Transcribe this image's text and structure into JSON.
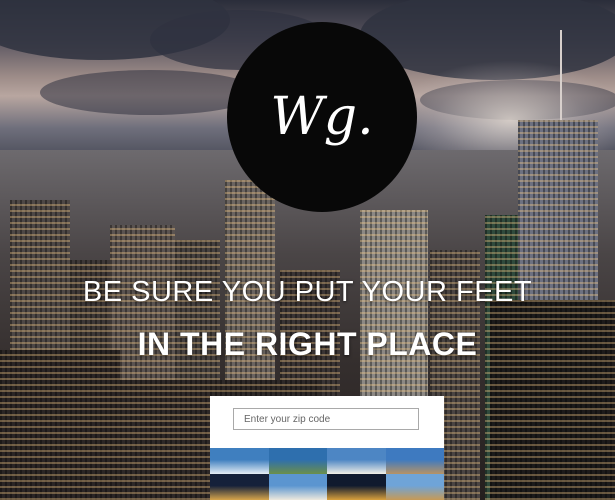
{
  "logo": {
    "text": "Wg."
  },
  "headline": {
    "line1": "BE SURE YOU PUT YOUR FEET",
    "line2": "IN THE RIGHT PLACE"
  },
  "search": {
    "placeholder": "Enter your zip code",
    "value": ""
  },
  "thumbnails": [
    {
      "name": "sydney-opera-house",
      "colors": [
        "#3f7fbf",
        "#e6eef5"
      ]
    },
    {
      "name": "mountain-lake",
      "colors": [
        "#2e6fae",
        "#6b8f4a"
      ]
    },
    {
      "name": "taj-mahal",
      "colors": [
        "#4d86c4",
        "#f1efe6"
      ]
    },
    {
      "name": "colosseum",
      "colors": [
        "#3e7ac0",
        "#b69366"
      ]
    },
    {
      "name": "louvre-night",
      "colors": [
        "#15213a",
        "#d7a54b"
      ]
    },
    {
      "name": "leaning-tower",
      "colors": [
        "#5b95d0",
        "#eee9dd"
      ]
    },
    {
      "name": "eiffel-tower-night",
      "colors": [
        "#101a2e",
        "#d9a03c"
      ]
    },
    {
      "name": "pyramids",
      "colors": [
        "#6fa4d8",
        "#c79a55"
      ]
    }
  ]
}
